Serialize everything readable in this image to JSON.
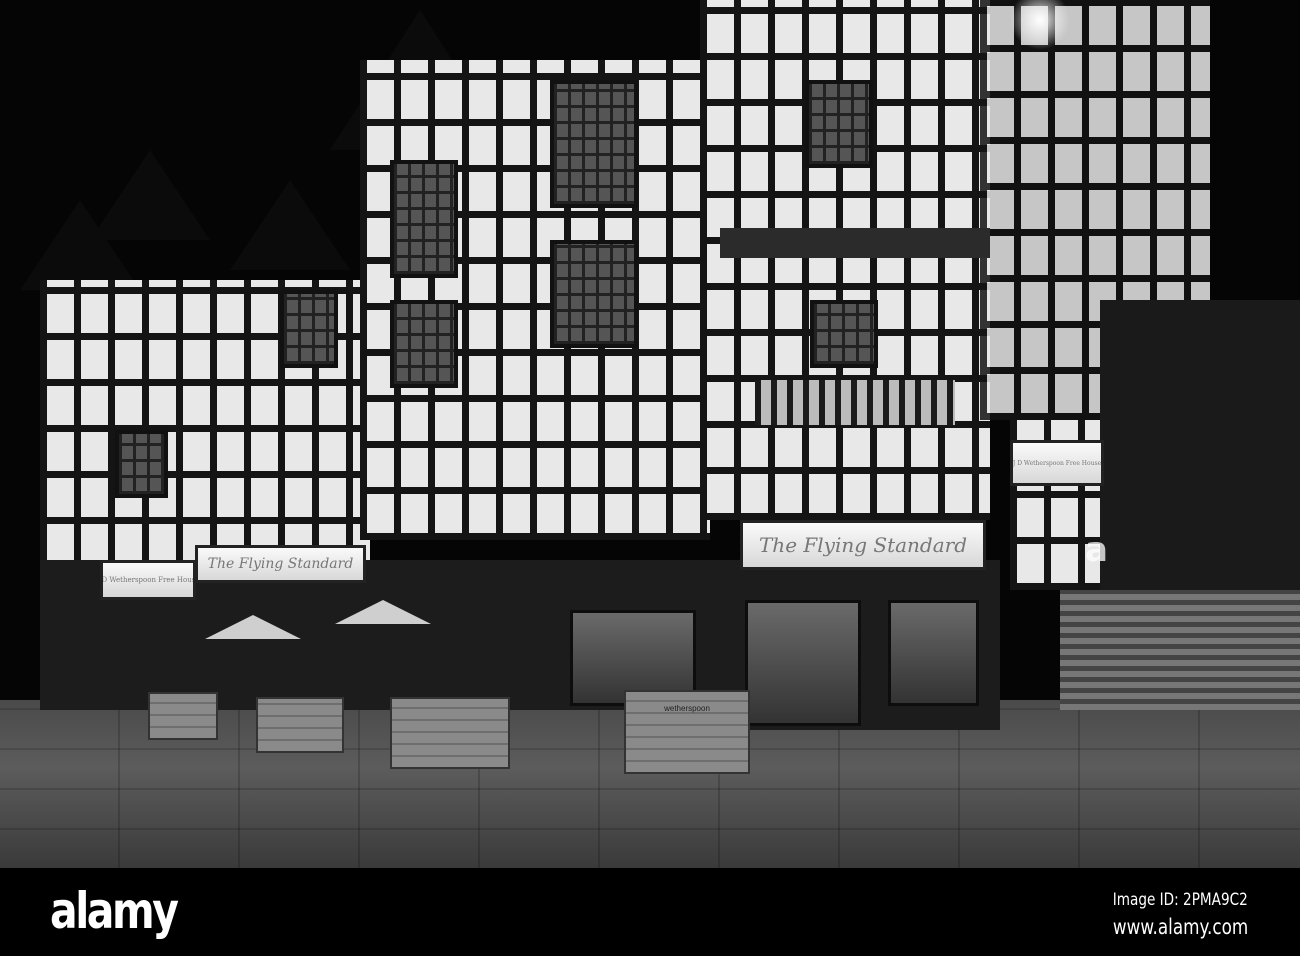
{
  "photo": {
    "signs": {
      "main_sign": "The Flying Standard",
      "left_sign": "The Flying Standard",
      "freehouse_sign": "J D Wetherspoon Free House",
      "corner_sign": "J D Wetherspoon Free House",
      "planter_label": "wetherspoon"
    },
    "watermark_glyph": "a"
  },
  "footer": {
    "logo": "alamy",
    "image_id": "Image ID: 2PMA9C2",
    "url": "www.alamy.com"
  }
}
